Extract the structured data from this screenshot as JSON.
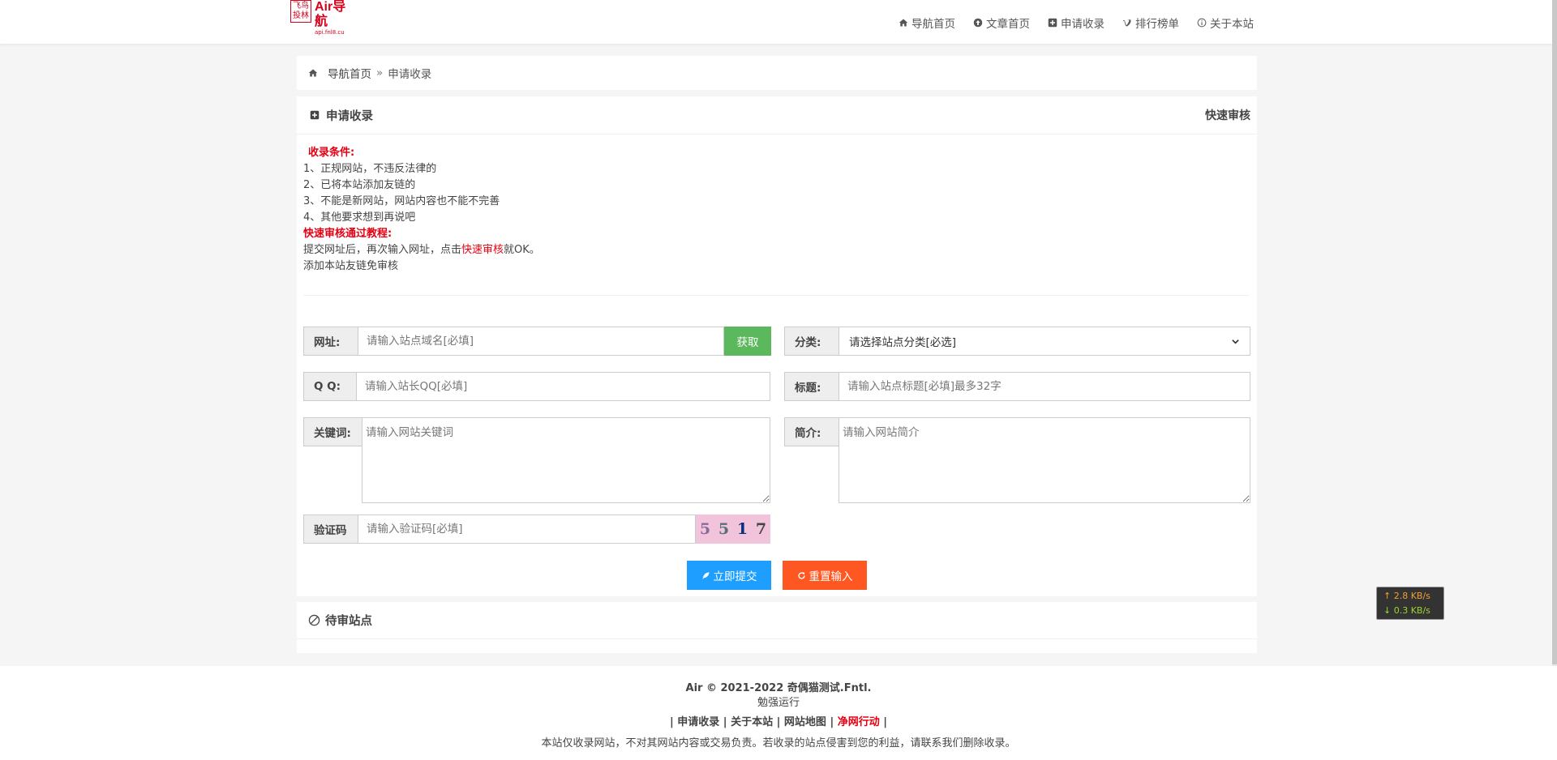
{
  "logo": {
    "seal_line1": "飞鸟",
    "seal_line2": "投林",
    "name": "Air导航",
    "sub": "api.fnl8.cu"
  },
  "nav": [
    {
      "label": "导航首页",
      "icon": "home-icon"
    },
    {
      "label": "文章首页",
      "icon": "upload-circle-icon"
    },
    {
      "label": "申请收录",
      "icon": "plus-square-icon"
    },
    {
      "label": "排行榜单",
      "icon": "vimeo-icon"
    },
    {
      "label": "关于本站",
      "icon": "info-circle-icon"
    }
  ],
  "breadcrumb": {
    "home": "导航首页",
    "sep": "»",
    "current": "申请收录"
  },
  "main": {
    "title": "申请收录",
    "right_link": "快速审核"
  },
  "conditions": {
    "heading": "收录条件:",
    "items": [
      "1、正规网站，不违反法律的",
      "2、已将本站添加友链的",
      "3、不能是新网站，网站内容也不能不完善",
      "4、其他要求想到再说吧"
    ],
    "quick_heading": "快速审核通过教程:",
    "quick_pre": "提交网址后，再次输入网址，点击",
    "quick_hl": "快速审核",
    "quick_post": "就OK。",
    "note": "添加本站友链免审核"
  },
  "form": {
    "url_label": "网址:",
    "url_placeholder": "请输入站点域名[必填]",
    "fetch_button": "获取",
    "category_label": "分类:",
    "category_selected": "请选择站点分类[必选]",
    "qq_label": "Q Q:",
    "qq_placeholder": "请输入站长QQ[必填]",
    "title_label": "标题:",
    "title_placeholder": "请输入站点标题[必填]最多32字",
    "keywords_label": "关键词:",
    "keywords_placeholder": "请输入网站关键词",
    "intro_label": "简介:",
    "intro_placeholder": "请输入网站简介",
    "captcha_label": "验证码",
    "captcha_placeholder": "请输入验证码[必填]",
    "captcha_chars": [
      "5",
      "5",
      "1",
      "7"
    ],
    "submit_button": "立即提交",
    "reset_button": "重置输入"
  },
  "pending": {
    "title": "待审站点"
  },
  "footer": {
    "copyright": "Air © 2021-2022 奇偶猫测试.Fntl.",
    "running": "勉强运行",
    "sep": "|",
    "links": [
      "申请收录",
      "关于本站",
      "网站地图",
      "净网行动"
    ],
    "notice": "本站仅收录网站，不对其网站内容或交易负责。若收录的站点侵害到您的利益，请联系我们删除收录。"
  },
  "speed": {
    "up": "↑ 2.8 KB/s",
    "down": "↓ 0.3 KB/s"
  },
  "colors": {
    "accent_red": "#e60012",
    "fetch_green": "#5cb85c",
    "submit_blue": "#1e9fff",
    "reset_orange": "#ff5722"
  }
}
